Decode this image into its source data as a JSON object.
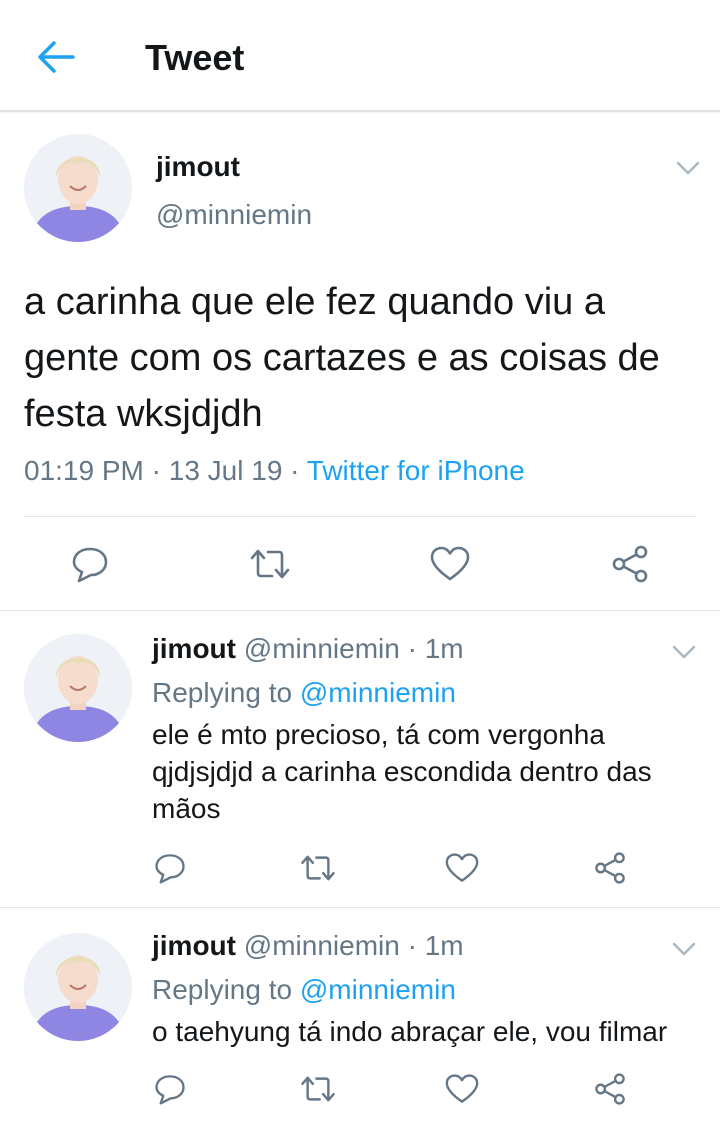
{
  "header": {
    "title": "Tweet"
  },
  "main_tweet": {
    "name": "jimout",
    "handle": "@minniemin",
    "text": "a carinha que ele fez quando viu a gente com os cartazes e as coisas de festa wksjdjdh",
    "time": "01:19 PM",
    "separator": " · ",
    "date": "13 Jul 19",
    "source": "Twitter for iPhone"
  },
  "replies": [
    {
      "name": "jimout",
      "handle": "@minniemin",
      "dot": " · ",
      "time": "1m",
      "replying_label": "Replying to ",
      "replying_to": "@minniemin",
      "text": "ele é mto precioso, tá com vergonha qjdjsjdjd a carinha escondida dentro das mãos"
    },
    {
      "name": "jimout",
      "handle": "@minniemin",
      "dot": " · ",
      "time": "1m",
      "replying_label": "Replying to ",
      "replying_to": "@minniemin",
      "text": "o taehyung tá indo abraçar ele, vou filmar"
    }
  ],
  "icons": {
    "back": "arrow-left-icon",
    "menu": "chevron-down-icon",
    "reply": "reply-bubble-icon",
    "retweet": "retweet-icon",
    "like": "heart-icon",
    "share": "share-icon"
  },
  "colors": {
    "accent": "#1da1f2",
    "secondary_text": "#657786",
    "icon": "#657786",
    "border": "#e1e8ed"
  }
}
